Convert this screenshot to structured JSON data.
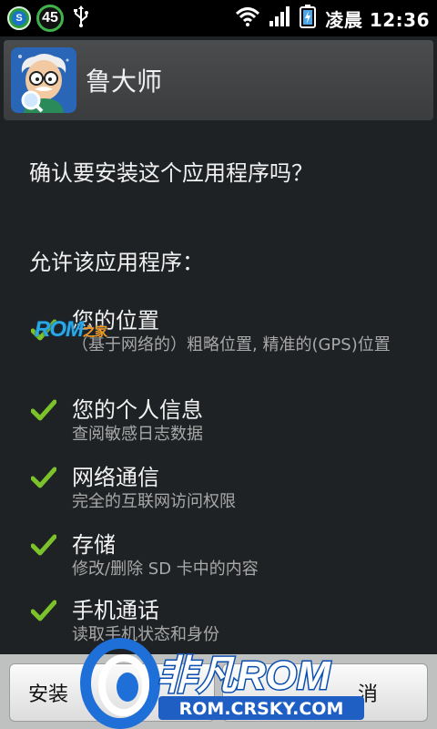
{
  "status_bar": {
    "notification_count": "45",
    "time": "凌晨 12:36",
    "icons": [
      "app-notification-icon",
      "counter-icon",
      "usb-icon",
      "wifi-icon",
      "signal-icon",
      "battery-charging-icon"
    ]
  },
  "header": {
    "app_name": "鲁大师",
    "icon": "master-lu-app-icon"
  },
  "main": {
    "question": "确认要安装这个应用程序吗？",
    "allow_label": "允许该应用程序：",
    "permissions": [
      {
        "title": "您的位置",
        "desc": "（基于网络的）粗略位置, 精准的(GPS)位置"
      },
      {
        "title": "您的个人信息",
        "desc": "查阅敏感日志数据"
      },
      {
        "title": "网络通信",
        "desc": "完全的互联网访问权限"
      },
      {
        "title": "存储",
        "desc": "修改/删除 SD 卡中的内容"
      },
      {
        "title": "手机通话",
        "desc": "读取手机状态和身份"
      }
    ]
  },
  "buttons": {
    "install": "安装",
    "cancel": "消"
  },
  "watermarks": {
    "rom_small": "ROM",
    "rom_small_suffix": "之家",
    "brand_title": "非凡ROM",
    "brand_url": "ROM.CRSKY.COM"
  },
  "colors": {
    "check_green": "#7cc22a",
    "background": "#1f2224",
    "title_bar": "#444648",
    "button_bar": "#bfc0c0"
  }
}
